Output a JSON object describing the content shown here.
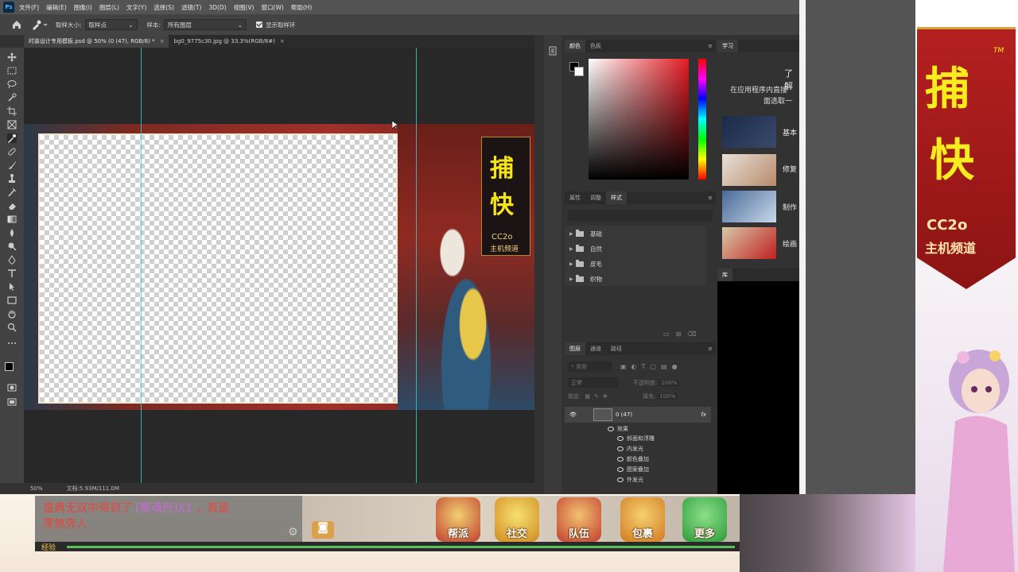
{
  "app": {
    "logo": "Ps",
    "menus": [
      "文件(F)",
      "编辑(E)",
      "图像(I)",
      "图层(L)",
      "文字(Y)",
      "选择(S)",
      "滤镜(T)",
      "3D(D)",
      "视图(V)",
      "窗口(W)",
      "帮助(H)"
    ]
  },
  "options": {
    "sample_size_label": "取样大小:",
    "sample_size_value": "取样点",
    "sample_label": "样本:",
    "sample_value": "所有图层",
    "show_ring_label": "显示取样环"
  },
  "tabs": [
    {
      "label": "时装设计专用模板.psd @ 50% (0 (47), RGB/8) *",
      "close": "×"
    },
    {
      "label": "bg0_9775c30.jpg @ 33.3%(RGB/8#)",
      "close": "×"
    }
  ],
  "status": {
    "zoom": "50%",
    "doc": "文档:5.93M/111.0M"
  },
  "canvas_art": {
    "title1": "捕",
    "title2": "快",
    "cc": "CC2o",
    "channel": "主机频道",
    "tm": "TM"
  },
  "color_panel": {
    "tabs": [
      "颜色",
      "色板"
    ]
  },
  "styles_panel": {
    "tabs": [
      "属性",
      "调整",
      "样式"
    ],
    "groups": [
      "基础",
      "自然",
      "皮毛",
      "织物"
    ]
  },
  "layers_panel": {
    "tabs": [
      "图层",
      "通道",
      "路径"
    ],
    "filter": "类型",
    "blend": "正常",
    "opacity_label": "不透明度:",
    "opacity_value": "100%",
    "lock_label": "锁定:",
    "fill_label": "填充:",
    "fill_value": "100%",
    "layer_name": "0 (47)",
    "fx": "fx",
    "effects_label": "效果",
    "effects": [
      "斜面和浮雕",
      "内发光",
      "颜色叠加",
      "图案叠加",
      "外发光"
    ]
  },
  "learn_panel": {
    "tab": "学习",
    "heading": "了解",
    "desc1": "在应用程序内直接",
    "desc2": "面选取一",
    "items": [
      "基本",
      "修复",
      "制作",
      "绘画"
    ],
    "library_tab": "库"
  },
  "game": {
    "chat_line1": "盛典无双中得到了",
    "chat_item": "[聚魂丹]X1",
    "chat_line1_end": "，真是",
    "chat_line2": "羡煞旁人",
    "level_label": "经验",
    "buttons": [
      "帮派",
      "社交",
      "队伍",
      "包裹",
      "更多"
    ],
    "colors": {
      "accent_red": "#b42020",
      "title_yellow": "#f6ec1e"
    }
  }
}
